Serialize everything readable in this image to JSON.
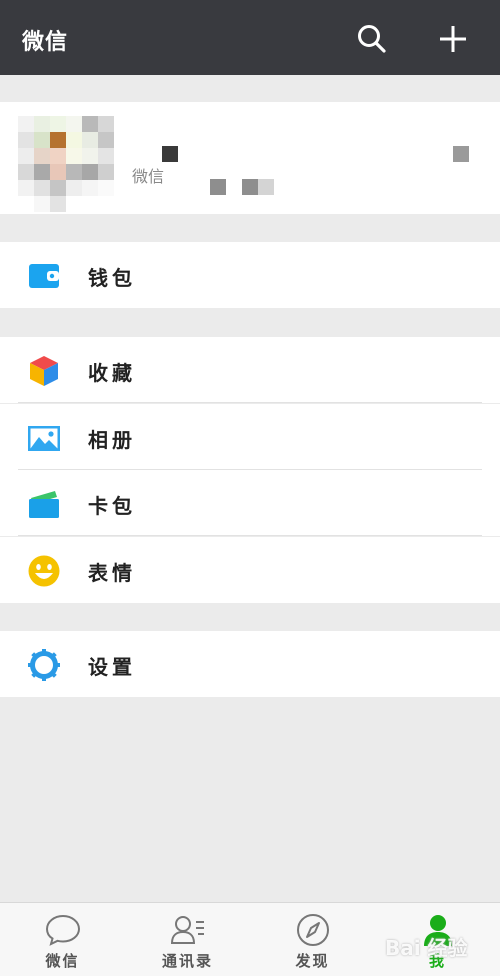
{
  "header": {
    "title": "微信",
    "search_icon": "search-icon",
    "add_icon": "plus-icon"
  },
  "profile": {
    "wechat_id_prefix": "微信"
  },
  "menu": {
    "wallet": {
      "label": "钱包",
      "icon": "wallet-icon",
      "color": "#1ba4ef"
    },
    "favorites": {
      "label": "收藏",
      "icon": "cube-icon"
    },
    "album": {
      "label": "相册",
      "icon": "picture-icon",
      "color": "#30a7f0"
    },
    "card_package": {
      "label": "卡包",
      "icon": "card-icon",
      "color": "#1aa0e8"
    },
    "stickers": {
      "label": "表情",
      "icon": "smiley-icon",
      "color": "#f5c200"
    },
    "settings": {
      "label": "设置",
      "icon": "gear-icon",
      "color": "#2a9ae6"
    }
  },
  "tabbar": {
    "tabs": [
      {
        "label": "微信",
        "icon": "chat-bubble-icon"
      },
      {
        "label": "通讯录",
        "icon": "contacts-icon"
      },
      {
        "label": "发现",
        "icon": "compass-icon"
      },
      {
        "label": "我",
        "icon": "person-icon",
        "active": true
      }
    ]
  },
  "colors": {
    "header_bg": "#393a3f",
    "page_bg": "#ebebeb",
    "accent": "#1aad19"
  },
  "watermark": "Bai 经验"
}
